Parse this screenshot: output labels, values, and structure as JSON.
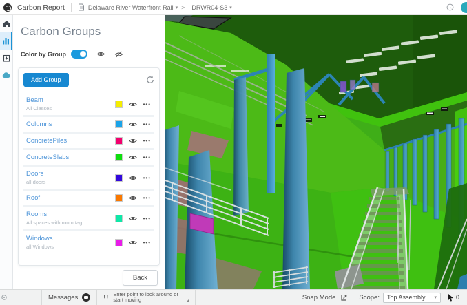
{
  "topbar": {
    "app_title": "Carbon Report",
    "project_name": "Delaware River Waterfront Rail",
    "model_name": "DRWR04-S3",
    "breadcrumb_separator": ">",
    "caret": "▾"
  },
  "panel": {
    "title": "Carbon Groups",
    "color_by_group_label": "Color by Group",
    "add_group_label": "Add Group",
    "back_label": "Back",
    "more_options_glyph": "•••",
    "groups": [
      {
        "name": "Beam",
        "subtitle": "All Classes",
        "color": "#f5ed00"
      },
      {
        "name": "Columns",
        "subtitle": "",
        "color": "#1ba3e8"
      },
      {
        "name": "ConcretePiles",
        "subtitle": "",
        "color": "#f2006e"
      },
      {
        "name": "ConcreteSlabs",
        "subtitle": "",
        "color": "#0fde0f"
      },
      {
        "name": "Doors",
        "subtitle": "all doors",
        "color": "#3208dc"
      },
      {
        "name": "Roof",
        "subtitle": "",
        "color": "#fa7800"
      },
      {
        "name": "Rooms",
        "subtitle": "All spaces with room tag",
        "color": "#0fe8a8"
      },
      {
        "name": "Windows",
        "subtitle": "all Windows",
        "color": "#e81ce8"
      }
    ]
  },
  "statusbar": {
    "messages_label": "Messages",
    "prompt_icon_glyph": "!!",
    "prompt_line1": "Enter point to look around or",
    "prompt_line2": "start moving",
    "snap_mode_label": "Snap Mode",
    "scope_label": "Scope:",
    "scope_value": "Top Assembly",
    "cursor_count": "0"
  },
  "colors": {
    "accent_blue": "#1788d1",
    "toggle_blue": "#1b9ade",
    "group_name_blue": "#4b93d8"
  }
}
